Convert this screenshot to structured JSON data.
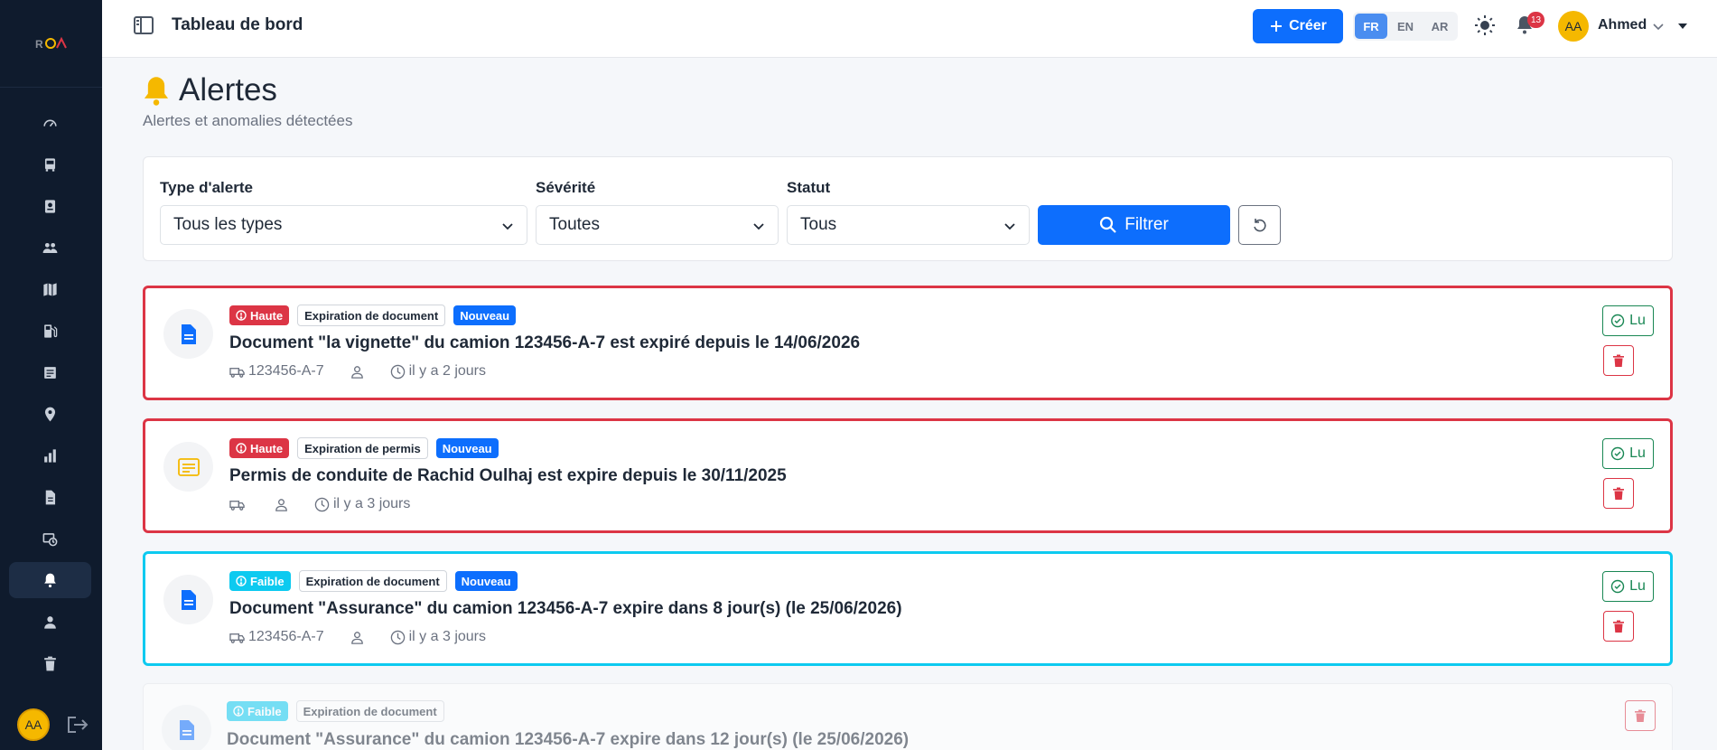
{
  "sidebar": {
    "logo_text": "RDN",
    "items": [
      {
        "icon": "gauge-icon",
        "name": "nav-dashboard"
      },
      {
        "icon": "bus-icon",
        "name": "nav-vehicles"
      },
      {
        "icon": "id-card-icon",
        "name": "nav-drivers"
      },
      {
        "icon": "users-icon",
        "name": "nav-users"
      },
      {
        "icon": "map-icon",
        "name": "nav-trips"
      },
      {
        "icon": "fuel-icon",
        "name": "nav-fuel"
      },
      {
        "icon": "receipt-icon",
        "name": "nav-expenses"
      },
      {
        "icon": "location-icon",
        "name": "nav-tracking"
      },
      {
        "icon": "bar-chart-icon",
        "name": "nav-reports"
      },
      {
        "icon": "document-icon",
        "name": "nav-documents"
      },
      {
        "icon": "maintenance-icon",
        "name": "nav-maintenance"
      },
      {
        "icon": "bell-icon",
        "name": "nav-alerts",
        "active": true
      },
      {
        "icon": "user-icon",
        "name": "nav-profile"
      },
      {
        "icon": "trash-icon",
        "name": "nav-trash"
      }
    ],
    "avatar_initials": "AA"
  },
  "topbar": {
    "title": "Tableau de bord",
    "create_label": "Créer",
    "languages": [
      "FR",
      "EN",
      "AR"
    ],
    "active_language": "FR",
    "notification_count": "13",
    "avatar_initials": "AA",
    "user_name": "Ahmed"
  },
  "page": {
    "title": "Alertes",
    "subtitle": "Alertes et anomalies détectées"
  },
  "filters": {
    "type_label": "Type d'alerte",
    "type_value": "Tous les types",
    "severity_label": "Sévérité",
    "severity_value": "Toutes",
    "status_label": "Statut",
    "status_value": "Tous",
    "filter_button": "Filtrer"
  },
  "alerts": [
    {
      "severity": "Haute",
      "type": "Expiration de document",
      "status": "Nouveau",
      "title": "Document \"la vignette\" du camion 123456-A-7 est expiré depuis le 14/06/2026",
      "vehicle": "123456-A-7",
      "time": "il y a 2 jours",
      "read_label": "Lu"
    },
    {
      "severity": "Haute",
      "type": "Expiration de permis",
      "status": "Nouveau",
      "title": "Permis de conduite de Rachid Oulhaj est expire depuis le 30/11/2025",
      "vehicle": "",
      "time": "il y a 3 jours",
      "read_label": "Lu"
    },
    {
      "severity": "Faible",
      "type": "Expiration de document",
      "status": "Nouveau",
      "title": "Document \"Assurance\" du camion 123456-A-7 expire dans 8 jour(s) (le 25/06/2026)",
      "vehicle": "123456-A-7",
      "time": "il y a 3 jours",
      "read_label": "Lu"
    },
    {
      "severity": "Faible",
      "type": "Expiration de document",
      "title": "Document \"Assurance\" du camion 123456-A-7 expire dans 12 jour(s) (le 25/06/2026)"
    }
  ],
  "colors": {
    "primary": "#0d6efd",
    "danger": "#dc3545",
    "info": "#0dcaf0",
    "success": "#198754",
    "sidebar": "#0f1b2d",
    "warning": "#f5b800"
  }
}
